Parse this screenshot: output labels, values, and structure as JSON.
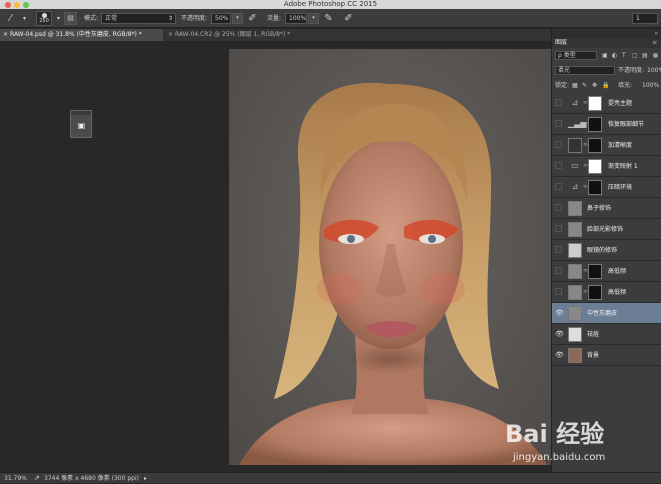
{
  "window": {
    "title": "Adobe Photoshop CC 2015"
  },
  "options_bar": {
    "brush_size": "250",
    "mode_label": "模式:",
    "mode_value": "正常",
    "opacity_label": "不透明度:",
    "opacity_value": "50%",
    "flow_label": "流量:",
    "flow_value": "100%",
    "right_value": "1"
  },
  "tabs": [
    {
      "label": "RAW-04.psd @ 31.8% (中性灰磨皮, RGB/8*) *",
      "active": true
    },
    {
      "label": "RAW-04.CR2 @ 25% (图层 1, RGB/8*) *",
      "active": false
    }
  ],
  "status": {
    "zoom": "31.79%",
    "doc_size": "3744 像素 x 4680 像素 (300 ppi)"
  },
  "layers_panel": {
    "title": "图层",
    "filter_kind": "ρ 类型",
    "blend_mode": "柔光",
    "opacity_label": "不透明度:",
    "opacity_value": "100%",
    "lock_label": "锁定:",
    "fill_label": "填充:",
    "fill_value": "100%",
    "layers": [
      {
        "name": "提亮主题",
        "visible": false,
        "selected": false
      },
      {
        "name": "恢复眼部细节",
        "visible": false,
        "selected": false
      },
      {
        "name": "加清晰度",
        "visible": false,
        "selected": false
      },
      {
        "name": "渐变映射 1",
        "visible": false,
        "selected": false
      },
      {
        "name": "压暗环境",
        "visible": false,
        "selected": false
      },
      {
        "name": "鼻子修饰",
        "visible": false,
        "selected": false
      },
      {
        "name": "脸部光影修饰",
        "visible": false,
        "selected": false
      },
      {
        "name": "眼镜的修饰",
        "visible": false,
        "selected": false
      },
      {
        "name": "高低频",
        "visible": false,
        "selected": false
      },
      {
        "name": "高低频",
        "visible": false,
        "selected": false
      },
      {
        "name": "中性灰磨皮",
        "visible": true,
        "selected": true
      },
      {
        "name": "祛痘",
        "visible": true,
        "selected": false
      },
      {
        "name": "背景",
        "visible": true,
        "selected": false
      }
    ]
  },
  "watermark": {
    "brand": "Bai 经验",
    "url": "jingyan.baidu.com"
  }
}
